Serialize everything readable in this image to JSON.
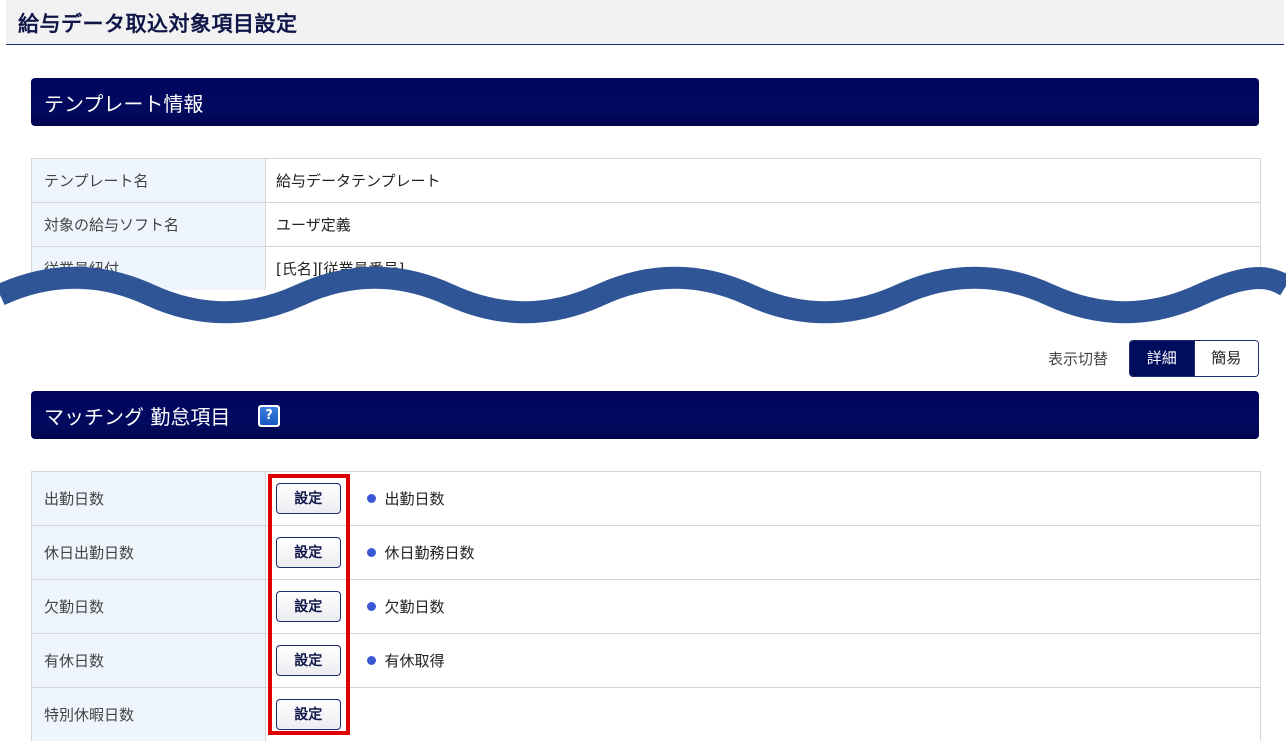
{
  "page": {
    "title": "給与データ取込対象項目設定"
  },
  "template_info": {
    "section_title": "テンプレート情報",
    "rows": [
      {
        "label": "テンプレート名",
        "value": "給与データテンプレート"
      },
      {
        "label": "対象の給与ソフト名",
        "value": "ユーザ定義"
      },
      {
        "label": "従業員紐付",
        "value": "[氏名][従業員番号]"
      }
    ]
  },
  "view_toggle": {
    "label": "表示切替",
    "options": [
      "詳細",
      "簡易"
    ],
    "selected": "詳細"
  },
  "matching": {
    "section_title": "マッチング 勤怠項目",
    "help_icon": "?",
    "rows": [
      {
        "label": "出勤日数",
        "button": "設定",
        "value": "出勤日数"
      },
      {
        "label": "休日出勤日数",
        "button": "設定",
        "value": "休日勤務日数"
      },
      {
        "label": "欠勤日数",
        "button": "設定",
        "value": "欠勤日数"
      },
      {
        "label": "有休日数",
        "button": "設定",
        "value": "有休取得"
      },
      {
        "label": "特別休暇日数",
        "button": "設定",
        "value": ""
      }
    ]
  },
  "colors": {
    "header_navy": "#000c5c",
    "label_bg": "#eef5fc",
    "bullet_blue": "#3b59d6",
    "highlight_red": "#e00000",
    "wave_blue": "#2f5597"
  },
  "icons": {
    "help": "question-mark-icon",
    "bullet": "dot-bullet-icon",
    "wave": "wavy-break-icon"
  }
}
